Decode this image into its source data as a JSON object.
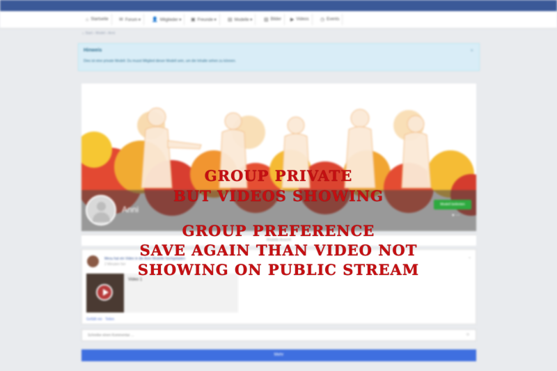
{
  "nav": {
    "items": [
      {
        "icon": "⌂",
        "label": "Startseite"
      },
      {
        "icon": "✉",
        "label": "Forum ▾"
      },
      {
        "icon": "👤",
        "label": "Mitglieder ▾"
      },
      {
        "icon": "▣",
        "label": "Freunde ▾"
      },
      {
        "icon": "▤",
        "label": "Modelle ▾"
      },
      {
        "icon": "▨",
        "label": "Bilder"
      },
      {
        "icon": "▶",
        "label": "Videos"
      },
      {
        "icon": "◷",
        "label": "Events"
      }
    ]
  },
  "breadcrumb": "⌂ Start › Model › Anni",
  "alert": {
    "title": "Hinweis",
    "text": "Dies ist eine private Modell. Du musst Mitglied dieser Modell sein, um die Inhalte sehen zu können.",
    "close": "×"
  },
  "group": {
    "name": "Anni",
    "join_label": "Modell beitreten",
    "icons": "♥ ⋯",
    "members_label": "Modelle Ansicht"
  },
  "post": {
    "author_line": "Mesu hat ein Video in die Anni Modelle hochgeladen",
    "time": "2 Minuten her",
    "video_title": "Video 1",
    "actions": "Gefällt mir · Teilen",
    "chevron": "⌄"
  },
  "comment": {
    "placeholder": "Schreibe einen Kommentar ...",
    "icon": "☺"
  },
  "more_label": "Mehr",
  "overlay": {
    "lines": [
      "GROUP PRIVATE",
      "BUT VIDEOS SHOWING",
      "GROUP PREFERENCE",
      "SAVE AGAIN THAN VIDEO NOT",
      "SHOWING ON PUBLIC STREAM"
    ]
  },
  "colors": {
    "topbar": "#3b5998",
    "overlay_text": "#c40f12",
    "join_button": "#2eaa3f",
    "more_button": "#3f6fe0"
  }
}
